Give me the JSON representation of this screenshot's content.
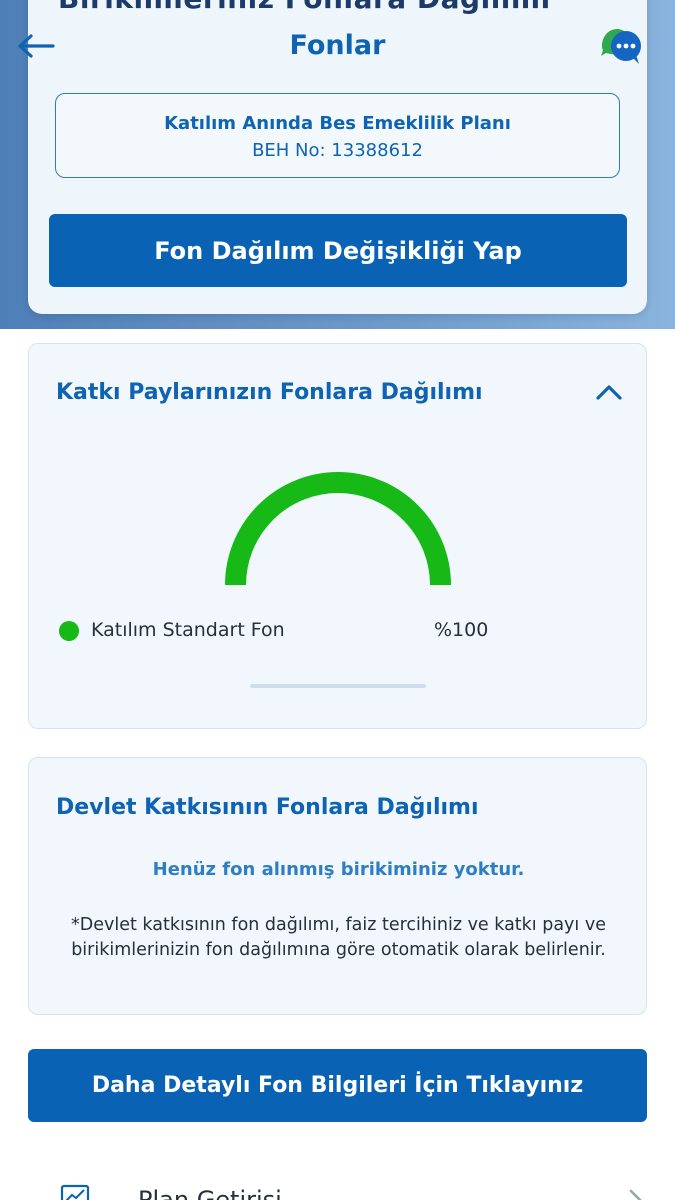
{
  "header": {
    "clipped_title": "Birikimleriniz Fonlara Dağılımı",
    "title": "Fonlar",
    "back_icon": "arrow-left-icon",
    "chat_icon": "chat-bubble-icon"
  },
  "plan": {
    "name": "Katılım Anında Bes Emeklilik Planı",
    "number": "BEH No: 13388612"
  },
  "buttons": {
    "change_allocation": "Fon Dağılım Değişikliği Yap",
    "detailed_info": "Daha Detaylı Fon Bilgileri İçin Tıklayınız"
  },
  "katki_card": {
    "title": "Katkı Paylarınızın Fonlara Dağılımı",
    "collapse_icon": "chevron-up-icon",
    "chart_data": {
      "type": "pie",
      "categories": [
        "Katılım Standart Fon"
      ],
      "values": [
        100
      ],
      "colors": [
        "#16b916"
      ]
    },
    "legend": [
      {
        "name": "Katılım Standart Fon",
        "percent": "%100",
        "color": "#16b916"
      }
    ]
  },
  "devlet_card": {
    "title": "Devlet Katkısının Fonlara Dağılımı",
    "empty_message": "Henüz fon alınmış birikiminiz yoktur.",
    "note": "*Devlet katkısının fon dağılımı, faiz tercihiniz ve katkı payı ve birikimlerinizin fon dağılımına göre otomatik olarak belirlenir."
  },
  "bottom_row": {
    "label": "Plan Getirisi",
    "icon": "chart-icon",
    "chevron": "chevron-right-icon"
  },
  "colors": {
    "primary": "#0a62b4",
    "title_blue": "#0e63b2",
    "card_bg": "#f1f7fc",
    "fund_green": "#16b916"
  }
}
